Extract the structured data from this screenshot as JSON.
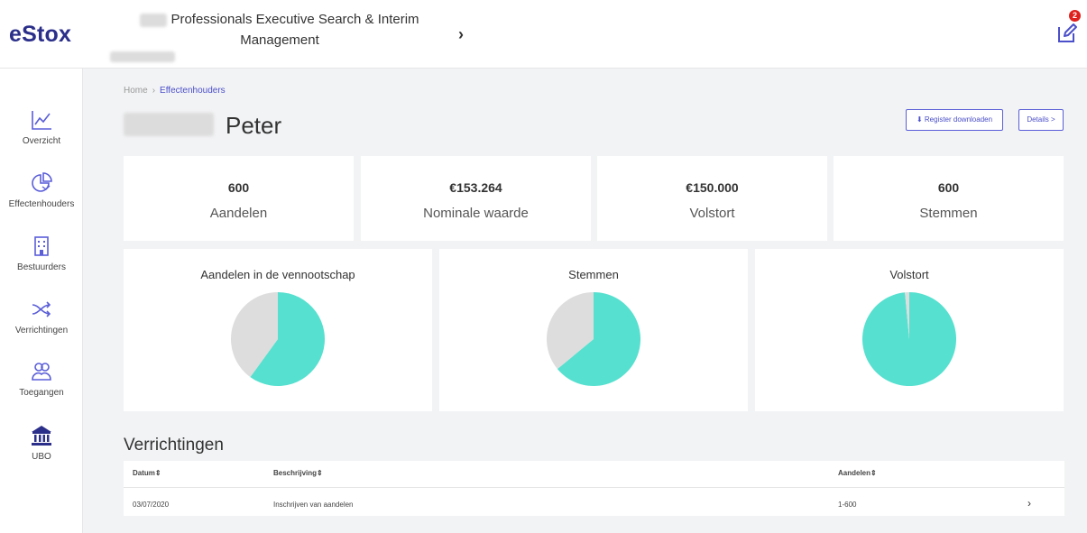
{
  "app": {
    "logo": "eStox"
  },
  "header": {
    "company_name": "Professionals Executive Search & Interim Management",
    "chevron": "›",
    "notification_count": "2"
  },
  "sidebar": {
    "items": [
      {
        "label": "Overzicht",
        "icon": "chart-line-icon"
      },
      {
        "label": "Effectenhouders",
        "icon": "pie-chart-icon"
      },
      {
        "label": "Bestuurders",
        "icon": "building-icon"
      },
      {
        "label": "Verrichtingen",
        "icon": "shuffle-icon"
      },
      {
        "label": "Toegangen",
        "icon": "users-icon"
      },
      {
        "label": "UBO",
        "icon": "bank-icon"
      }
    ]
  },
  "breadcrumb": {
    "home": "Home",
    "separator": "›",
    "current": "Effectenhouders"
  },
  "page": {
    "title": "Peter"
  },
  "buttons": {
    "download": "⬇ Register downloaden",
    "details": "Details >"
  },
  "stats": [
    {
      "value": "600",
      "label": "Aandelen"
    },
    {
      "value": "€153.264",
      "label": "Nominale waarde"
    },
    {
      "value": "€150.000",
      "label": "Volstort"
    },
    {
      "value": "600",
      "label": "Stemmen"
    }
  ],
  "chart_data": [
    {
      "type": "pie",
      "title": "Aandelen in de vennootschap",
      "slices": [
        {
          "value": 60,
          "color": "#56e0cf"
        },
        {
          "value": 40,
          "color": "#dddddd"
        }
      ]
    },
    {
      "type": "pie",
      "title": "Stemmen",
      "slices": [
        {
          "value": 64,
          "color": "#56e0cf"
        },
        {
          "value": 36,
          "color": "#dddddd"
        }
      ]
    },
    {
      "type": "pie",
      "title": "Volstort",
      "slices": [
        {
          "value": 98.5,
          "color": "#56e0cf"
        },
        {
          "value": 1.5,
          "color": "#dddddd"
        }
      ]
    }
  ],
  "transactions": {
    "title": "Verrichtingen",
    "columns": [
      "Datum⇕",
      "Beschrijving⇕",
      "Aandelen⇕"
    ],
    "rows": [
      {
        "date": "03/07/2020",
        "description": "Inschrijven van aandelen",
        "shares": "1-600"
      }
    ],
    "row_chevron": "›"
  },
  "colors": {
    "accent": "#4b4fc9",
    "logo": "#2b2f8a",
    "teal": "#56e0cf",
    "grey": "#dddddd",
    "badge": "#e0201c"
  }
}
